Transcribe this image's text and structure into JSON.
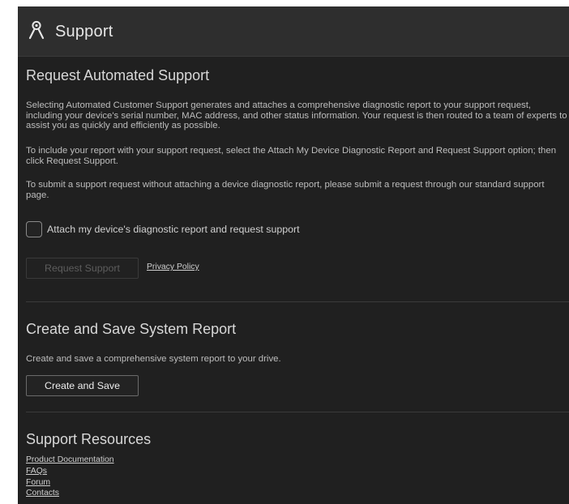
{
  "header": {
    "title": "Support",
    "icon": "user-icon"
  },
  "automated": {
    "title": "Request Automated Support",
    "para1": "Selecting Automated Customer Support generates and attaches a comprehensive diagnostic report to your support request, including your device's serial number, MAC address, and other status information. Your request is then routed to a team of experts to assist you as quickly and efficiently as possible.",
    "para2": "To include your report with your support request, select the Attach My Device Diagnostic Report and Request Support option; then click Request Support.",
    "para3": "To submit a support request without attaching a device diagnostic report, please submit a request through our standard support page.",
    "checkbox_label": "Attach my device's diagnostic report and request support",
    "checkbox_checked": false,
    "request_button": "Request Support",
    "request_button_enabled": false,
    "privacy_link": "Privacy Policy"
  },
  "report": {
    "title": "Create and Save System Report",
    "description": "Create and save a comprehensive system report to your drive.",
    "button": "Create and Save"
  },
  "resources": {
    "title": "Support Resources",
    "links": [
      "Product Documentation",
      "FAQs",
      "Forum",
      "Contacts"
    ]
  },
  "colors": {
    "background": "#202020",
    "header": "#2e2e2e",
    "text": "#bdbdbd",
    "heading": "#d8d8d8"
  }
}
